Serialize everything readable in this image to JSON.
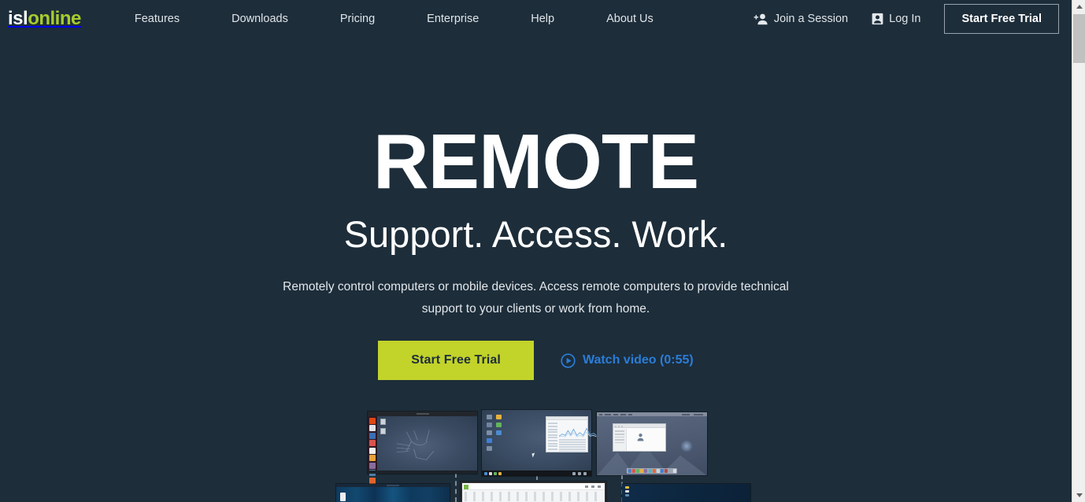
{
  "brand": {
    "logo_part1": "isl",
    "logo_part2": "online",
    "green": "#c2d32a",
    "logo_green": "#a8cc2e",
    "link_blue": "#2b7dd8",
    "background": "#1d2d3a"
  },
  "navbar": {
    "links": [
      {
        "label": "Features"
      },
      {
        "label": "Downloads"
      },
      {
        "label": "Pricing"
      },
      {
        "label": "Enterprise"
      },
      {
        "label": "Help"
      },
      {
        "label": "About Us"
      }
    ],
    "join_session": {
      "label": "Join a Session",
      "icon": "person-add-icon"
    },
    "log_in": {
      "label": "Log In",
      "icon": "id-badge-icon"
    },
    "trial_button": {
      "label": "Start Free Trial"
    }
  },
  "hero": {
    "title": "REMOTE",
    "subtitle": "Support. Access. Work.",
    "description": "Remotely control computers or mobile devices. Access remote computers to provide technical support to your clients or work from home.",
    "primary_cta": "Start Free Trial",
    "video_link": "Watch video (0:55)",
    "video_icon": "play-circle-icon"
  },
  "collage": {
    "screenshots": [
      {
        "name": "ubuntu-desktop",
        "os": "Linux"
      },
      {
        "name": "windows-desktop",
        "os": "Windows"
      },
      {
        "name": "macos-desktop",
        "os": "macOS"
      },
      {
        "name": "mobile-device-window",
        "os": "Mobile"
      },
      {
        "name": "office-application-window",
        "os": "Windows"
      },
      {
        "name": "server-console-window",
        "os": "Linux"
      }
    ]
  },
  "scrollbar": {
    "up_icon": "chevron-up-icon",
    "down_icon": "chevron-down-icon",
    "position": "top"
  }
}
